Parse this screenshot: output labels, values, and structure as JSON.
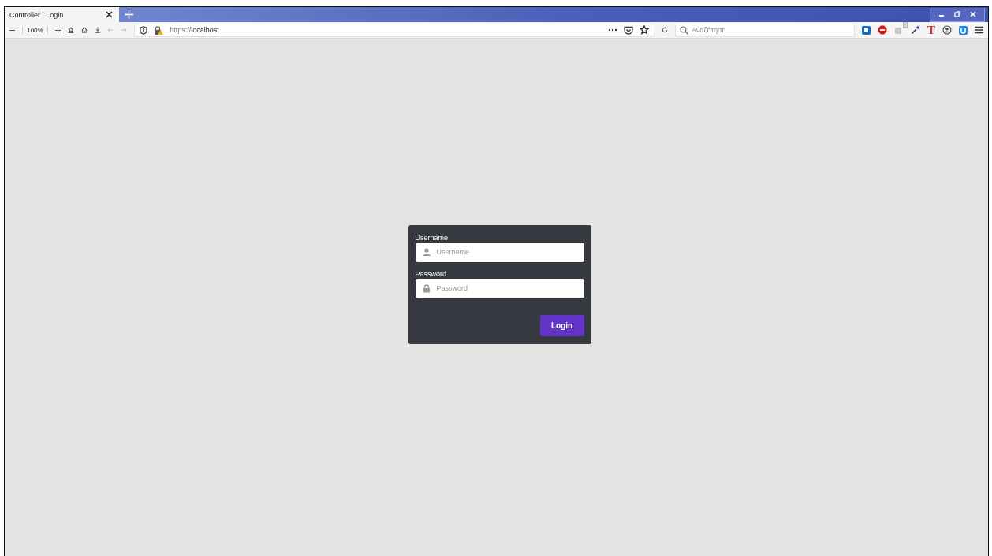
{
  "browser": {
    "tab": {
      "title": "Controller | Login",
      "selected": true
    },
    "zoom": "100%",
    "url": {
      "scheme": "https://",
      "host": "localhost"
    },
    "search": {
      "placeholder": "Αναζήτηση"
    },
    "extension_badge": "0",
    "extension_glyph": "T"
  },
  "login": {
    "fields": [
      {
        "label": "Username",
        "placeholder": "Username",
        "kind": "user"
      },
      {
        "label": "Password",
        "placeholder": "Password",
        "kind": "lock"
      }
    ],
    "button": "Login"
  }
}
